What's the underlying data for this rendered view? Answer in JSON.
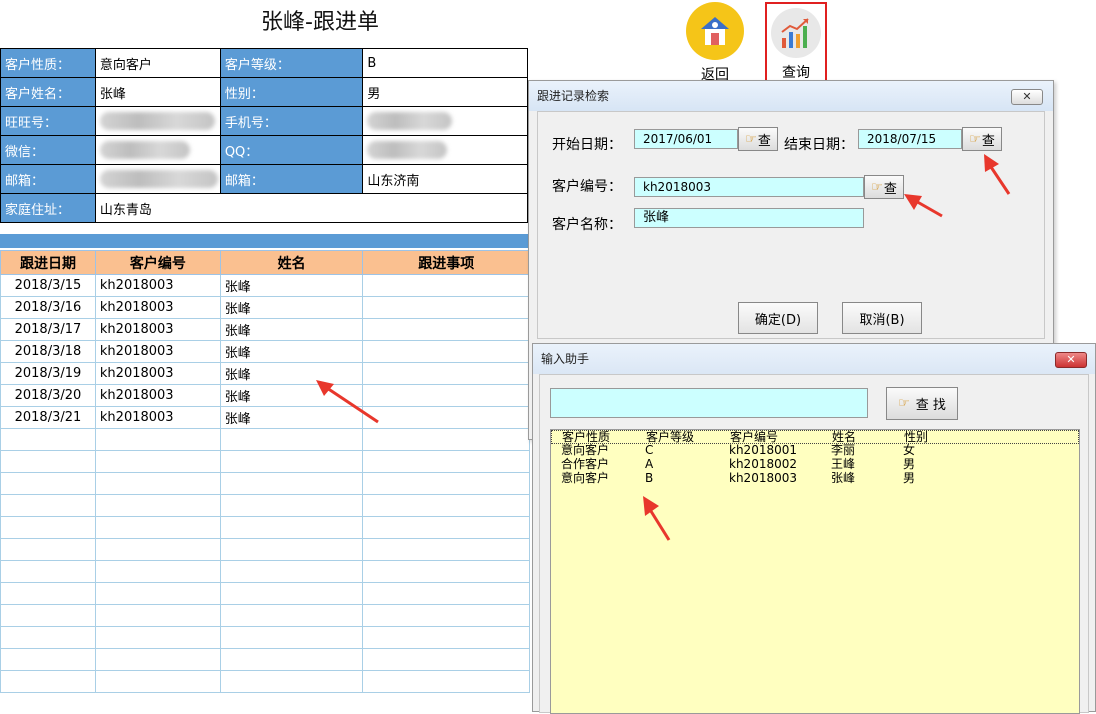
{
  "sheet": {
    "title": "张峰-跟进单",
    "info_rows": [
      {
        "l1": "客户性质：",
        "v1": "意向客户",
        "l2": "客户等级：",
        "v2": "B"
      },
      {
        "l1": "客户姓名：",
        "v1": "张峰",
        "l2": "性别：",
        "v2": "男"
      },
      {
        "l1": "旺旺号：",
        "v1": "",
        "l2": "手机号：",
        "v2": ""
      },
      {
        "l1": "微信：",
        "v1": "",
        "l2": "QQ：",
        "v2": ""
      },
      {
        "l1": "邮箱：",
        "v1": "",
        "l2": "邮箱：",
        "v2": "山东济南"
      }
    ],
    "address_label": "家庭住址：",
    "address_value": "山东青岛",
    "columns": [
      "跟进日期",
      "客户编号",
      "姓名",
      "跟进事项"
    ],
    "rows": [
      [
        "2018/3/15",
        "kh2018003",
        "张峰",
        ""
      ],
      [
        "2018/3/16",
        "kh2018003",
        "张峰",
        ""
      ],
      [
        "2018/3/17",
        "kh2018003",
        "张峰",
        ""
      ],
      [
        "2018/3/18",
        "kh2018003",
        "张峰",
        ""
      ],
      [
        "2018/3/19",
        "kh2018003",
        "张峰",
        ""
      ],
      [
        "2018/3/20",
        "kh2018003",
        "张峰",
        ""
      ],
      [
        "2018/3/21",
        "kh2018003",
        "张峰",
        ""
      ]
    ]
  },
  "ribbon": {
    "back_label": "返回",
    "query_label": "查询"
  },
  "dialog1": {
    "title": "跟进记录检索",
    "close_label": "✕",
    "start_label": "开始日期：",
    "start_value": "2017/06/01",
    "end_label": "结束日期：",
    "end_value": "2018/07/15",
    "code_label": "客户编号：",
    "code_value": "kh2018003",
    "name_label": "客户名称：",
    "name_value": "张峰",
    "query_btn": "查",
    "ok_label": "确定(D)",
    "cancel_label": "取消(B)"
  },
  "dialog2": {
    "title": "输入助手",
    "close_label": "✕",
    "search_value": "",
    "find_label": "查 找",
    "list_header": [
      "客户性质",
      "客户等级",
      "客户编号",
      "姓名",
      "性别"
    ],
    "list_rows": [
      [
        "意向客户",
        "C",
        "kh2018001",
        "李丽",
        "女"
      ],
      [
        "合作客户",
        "A",
        "kh2018002",
        "王峰",
        "男"
      ],
      [
        "意向客户",
        "B",
        "kh2018003",
        "张峰",
        "男"
      ]
    ]
  },
  "colors": {
    "label_blue": "#5b9bd5",
    "header_orange": "#fac090",
    "field_cyan": "#ccffff",
    "list_yellow": "#ffffc0",
    "arrow_red": "#e8372c"
  }
}
